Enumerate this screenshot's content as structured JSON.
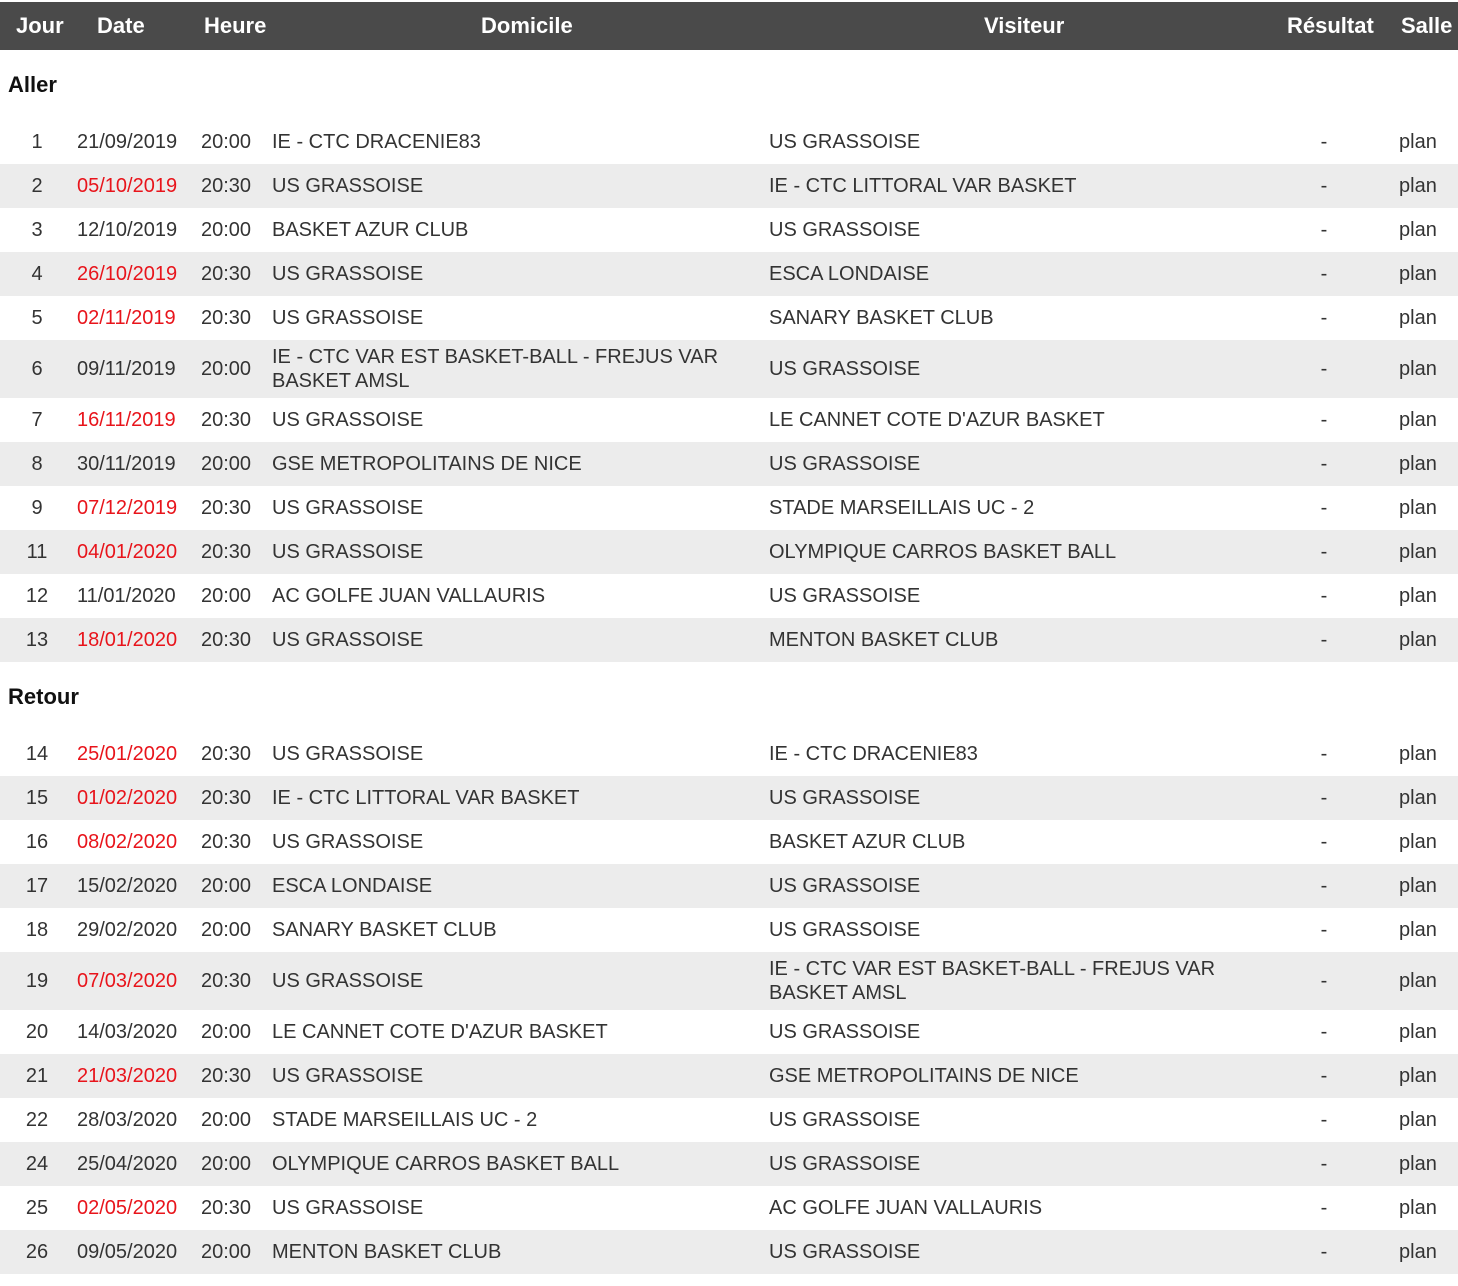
{
  "header": {
    "jour": "Jour",
    "date": "Date",
    "heure": "Heure",
    "domicile": "Domicile",
    "visiteur": "Visiteur",
    "resultat": "Résultat",
    "salle": "Salle"
  },
  "sections": [
    {
      "title": "Aller",
      "rows": [
        {
          "jour": "1",
          "date": "21/09/2019",
          "date_color": "#333333",
          "heure": "20:00",
          "domicile": "IE - CTC DRACENIE83",
          "visiteur": "US GRASSOISE",
          "resultat": "-",
          "salle": "plan"
        },
        {
          "jour": "2",
          "date": "05/10/2019",
          "date_color": "#e8141b",
          "heure": "20:30",
          "domicile": "US GRASSOISE",
          "visiteur": "IE - CTC LITTORAL VAR BASKET",
          "resultat": "-",
          "salle": "plan"
        },
        {
          "jour": "3",
          "date": "12/10/2019",
          "date_color": "#333333",
          "heure": "20:00",
          "domicile": "BASKET AZUR CLUB",
          "visiteur": "US GRASSOISE",
          "resultat": "-",
          "salle": "plan"
        },
        {
          "jour": "4",
          "date": "26/10/2019",
          "date_color": "#e8141b",
          "heure": "20:30",
          "domicile": "US GRASSOISE",
          "visiteur": "ESCA LONDAISE",
          "resultat": "-",
          "salle": "plan"
        },
        {
          "jour": "5",
          "date": "02/11/2019",
          "date_color": "#e8141b",
          "heure": "20:30",
          "domicile": "US GRASSOISE",
          "visiteur": "SANARY BASKET CLUB",
          "resultat": "-",
          "salle": "plan"
        },
        {
          "jour": "6",
          "date": "09/11/2019",
          "date_color": "#333333",
          "heure": "20:00",
          "domicile": "IE - CTC VAR EST BASKET-BALL - FREJUS VAR BASKET AMSL",
          "visiteur": "US GRASSOISE",
          "resultat": "-",
          "salle": "plan"
        },
        {
          "jour": "7",
          "date": "16/11/2019",
          "date_color": "#e8141b",
          "heure": "20:30",
          "domicile": "US GRASSOISE",
          "visiteur": "LE CANNET COTE D'AZUR BASKET",
          "resultat": "-",
          "salle": "plan"
        },
        {
          "jour": "8",
          "date": "30/11/2019",
          "date_color": "#333333",
          "heure": "20:00",
          "domicile": "GSE METROPOLITAINS DE NICE",
          "visiteur": "US GRASSOISE",
          "resultat": "-",
          "salle": "plan"
        },
        {
          "jour": "9",
          "date": "07/12/2019",
          "date_color": "#e8141b",
          "heure": "20:30",
          "domicile": "US GRASSOISE",
          "visiteur": "STADE MARSEILLAIS UC - 2",
          "resultat": "-",
          "salle": "plan"
        },
        {
          "jour": "11",
          "date": "04/01/2020",
          "date_color": "#e8141b",
          "heure": "20:30",
          "domicile": "US GRASSOISE",
          "visiteur": "OLYMPIQUE CARROS BASKET BALL",
          "resultat": "-",
          "salle": "plan"
        },
        {
          "jour": "12",
          "date": "11/01/2020",
          "date_color": "#333333",
          "heure": "20:00",
          "domicile": "AC GOLFE JUAN VALLAURIS",
          "visiteur": "US GRASSOISE",
          "resultat": "-",
          "salle": "plan"
        },
        {
          "jour": "13",
          "date": "18/01/2020",
          "date_color": "#e8141b",
          "heure": "20:30",
          "domicile": "US GRASSOISE",
          "visiteur": "MENTON BASKET CLUB",
          "resultat": "-",
          "salle": "plan"
        }
      ]
    },
    {
      "title": "Retour",
      "rows": [
        {
          "jour": "14",
          "date": "25/01/2020",
          "date_color": "#e8141b",
          "heure": "20:30",
          "domicile": "US GRASSOISE",
          "visiteur": "IE - CTC DRACENIE83",
          "resultat": "-",
          "salle": "plan"
        },
        {
          "jour": "15",
          "date": "01/02/2020",
          "date_color": "#e8141b",
          "heure": "20:30",
          "domicile": "IE - CTC LITTORAL VAR BASKET",
          "visiteur": "US GRASSOISE",
          "resultat": "-",
          "salle": "plan"
        },
        {
          "jour": "16",
          "date": "08/02/2020",
          "date_color": "#e8141b",
          "heure": "20:30",
          "domicile": "US GRASSOISE",
          "visiteur": "BASKET AZUR CLUB",
          "resultat": "-",
          "salle": "plan"
        },
        {
          "jour": "17",
          "date": "15/02/2020",
          "date_color": "#333333",
          "heure": "20:00",
          "domicile": "ESCA LONDAISE",
          "visiteur": "US GRASSOISE",
          "resultat": "-",
          "salle": "plan"
        },
        {
          "jour": "18",
          "date": "29/02/2020",
          "date_color": "#333333",
          "heure": "20:00",
          "domicile": "SANARY BASKET CLUB",
          "visiteur": "US GRASSOISE",
          "resultat": "-",
          "salle": "plan"
        },
        {
          "jour": "19",
          "date": "07/03/2020",
          "date_color": "#e8141b",
          "heure": "20:30",
          "domicile": "US GRASSOISE",
          "visiteur": "IE - CTC VAR EST BASKET-BALL - FREJUS VAR BASKET AMSL",
          "resultat": "-",
          "salle": "plan"
        },
        {
          "jour": "20",
          "date": "14/03/2020",
          "date_color": "#333333",
          "heure": "20:00",
          "domicile": "LE CANNET COTE D'AZUR BASKET",
          "visiteur": "US GRASSOISE",
          "resultat": "-",
          "salle": "plan"
        },
        {
          "jour": "21",
          "date": "21/03/2020",
          "date_color": "#e8141b",
          "heure": "20:30",
          "domicile": "US GRASSOISE",
          "visiteur": "GSE METROPOLITAINS DE NICE",
          "resultat": "-",
          "salle": "plan"
        },
        {
          "jour": "22",
          "date": "28/03/2020",
          "date_color": "#333333",
          "heure": "20:00",
          "domicile": "STADE MARSEILLAIS UC - 2",
          "visiteur": "US GRASSOISE",
          "resultat": "-",
          "salle": "plan"
        },
        {
          "jour": "24",
          "date": "25/04/2020",
          "date_color": "#333333",
          "heure": "20:00",
          "domicile": "OLYMPIQUE CARROS BASKET BALL",
          "visiteur": "US GRASSOISE",
          "resultat": "-",
          "salle": "plan"
        },
        {
          "jour": "25",
          "date": "02/05/2020",
          "date_color": "#e8141b",
          "heure": "20:30",
          "domicile": "US GRASSOISE",
          "visiteur": "AC GOLFE JUAN VALLAURIS",
          "resultat": "-",
          "salle": "plan"
        },
        {
          "jour": "26",
          "date": "09/05/2020",
          "date_color": "#333333",
          "heure": "20:00",
          "domicile": "MENTON BASKET CLUB",
          "visiteur": "US GRASSOISE",
          "resultat": "-",
          "salle": "plan"
        }
      ]
    }
  ]
}
